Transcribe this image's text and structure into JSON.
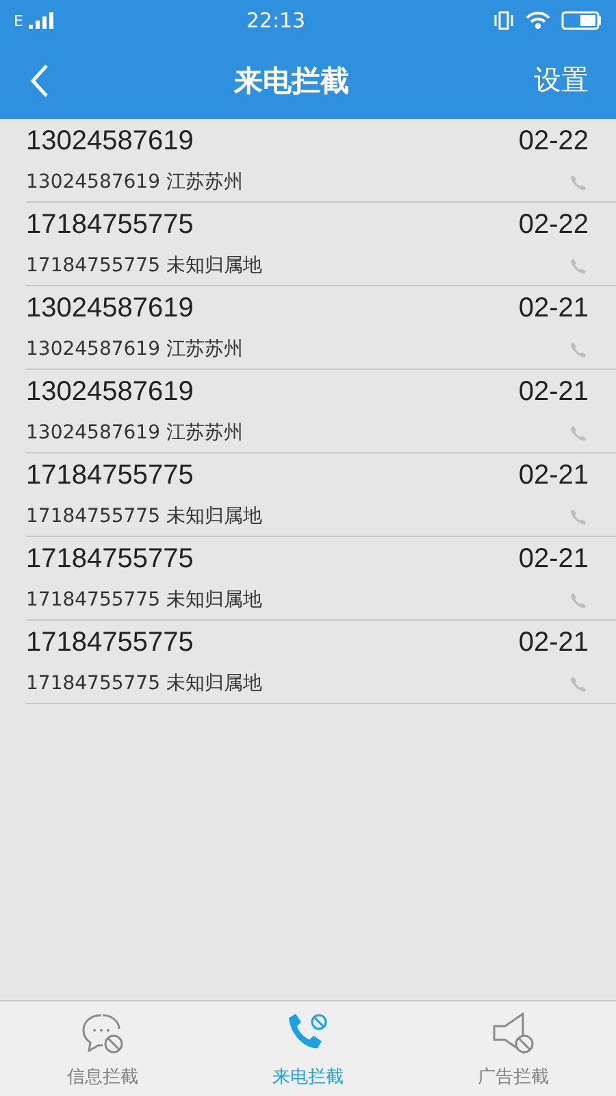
{
  "status_bar": {
    "network": "E",
    "time": "22:13"
  },
  "header": {
    "title": "来电拦截",
    "action": "设置"
  },
  "calls": [
    {
      "number": "13024587619",
      "date": "02-22",
      "detail": "13024587619 江苏苏州"
    },
    {
      "number": "17184755775",
      "date": "02-22",
      "detail": "17184755775 未知归属地"
    },
    {
      "number": "13024587619",
      "date": "02-21",
      "detail": "13024587619 江苏苏州"
    },
    {
      "number": "13024587619",
      "date": "02-21",
      "detail": "13024587619 江苏苏州"
    },
    {
      "number": "17184755775",
      "date": "02-21",
      "detail": "17184755775 未知归属地"
    },
    {
      "number": "17184755775",
      "date": "02-21",
      "detail": "17184755775 未知归属地"
    },
    {
      "number": "17184755775",
      "date": "02-21",
      "detail": "17184755775 未知归属地"
    }
  ],
  "tabs": [
    {
      "label": "信息拦截",
      "kind": "message",
      "selected": false
    },
    {
      "label": "来电拦截",
      "kind": "call",
      "selected": true
    },
    {
      "label": "广告拦截",
      "kind": "ad",
      "selected": false
    }
  ]
}
